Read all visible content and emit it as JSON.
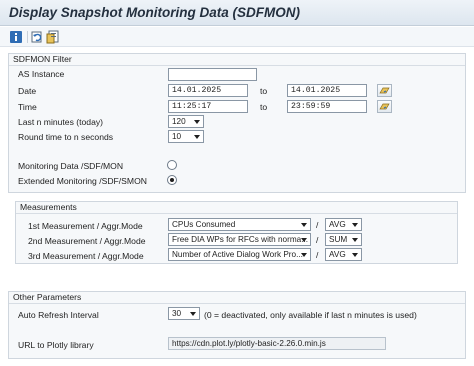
{
  "window": {
    "title": "Display Snapshot Monitoring Data (SDFMON)"
  },
  "toolbar": {
    "buttons": [
      {
        "icon": "info-icon"
      },
      {
        "icon": "refresh-icon"
      },
      {
        "icon": "variant-icon"
      }
    ]
  },
  "filter": {
    "title": "SDFMON Filter",
    "as_instance": {
      "label": "AS Instance",
      "value": ""
    },
    "date": {
      "label": "Date",
      "from": "14.01.2025",
      "to_label": "to",
      "to": "14.01.2025"
    },
    "time": {
      "label": "Time",
      "from": "11:25:17",
      "to_label": "to",
      "to": "23:59:59"
    },
    "last_n_minutes": {
      "label": "Last n minutes (today)",
      "value": "120"
    },
    "round_time": {
      "label": "Round time to n seconds",
      "value": "10"
    },
    "monitoring_data": {
      "label": "Monitoring Data /SDF/MON",
      "selected": false
    },
    "extended_monitoring": {
      "label": "Extended Monitoring /SDF/SMON",
      "selected": true
    }
  },
  "measurements": {
    "title": "Measurements",
    "rows": [
      {
        "label": "1st Measurement / Aggr.Mode",
        "measure": "CPUs Consumed",
        "aggr": "AVG"
      },
      {
        "label": "2nd Measurement / Aggr.Mode",
        "measure": "Free DIA WPs for RFCs with norma...",
        "aggr": "SUM"
      },
      {
        "label": "3rd Measurement / Aggr.Mode",
        "measure": "Number of Active Dialog Work Pro...",
        "aggr": "AVG"
      }
    ],
    "separator": "/"
  },
  "other": {
    "title": "Other Parameters",
    "auto_refresh": {
      "label": "Auto Refresh Interval",
      "value": "30",
      "note": "(0 = deactivated, only available if last n minutes is used)"
    },
    "plotly_url": {
      "label": "URL to Plotly library",
      "value": "https://cdn.plot.ly/plotly-basic-2.26.0.min.js"
    }
  }
}
